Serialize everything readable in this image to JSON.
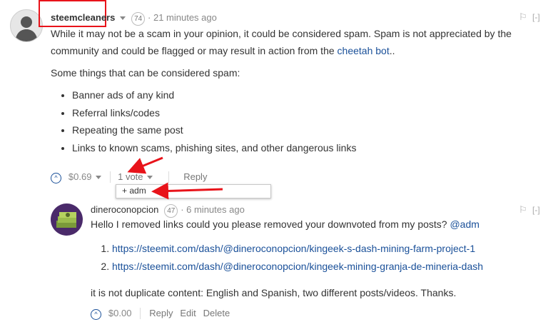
{
  "comment1": {
    "author": "steemcleaners",
    "reputation": "74",
    "time": "21 minutes ago",
    "collapse_label": "[-]",
    "paragraph1_a": "While it may not be a scam in your opinion, it could be considered spam. Spam is not appreciated by the community and could be flagged or may result in action from the ",
    "paragraph1_link": "cheetah bot",
    "paragraph1_b": "..",
    "paragraph2": "Some things that can be considered spam:",
    "list": [
      "Banner ads of any kind",
      "Referral links/codes",
      "Repeating the same post",
      "Links to known scams, phishing sites, and other dangerous links"
    ],
    "payout": "$0.69",
    "votes": "1 vote",
    "reply_label": "Reply",
    "voter": "+ adm"
  },
  "comment2": {
    "author": "dineroconopcion",
    "reputation": "47",
    "time": "6 minutes ago",
    "collapse_label": "[-]",
    "paragraph1": "Hello I removed links could you please removed your downvoted from my posts? ",
    "mention": "@adm",
    "links": [
      "https://steemit.com/dash/@dineroconopcion/kingeek-s-dash-mining-farm-project-1",
      "https://steemit.com/dash/@dineroconopcion/kingeek-mining-granja-de-mineria-dash"
    ],
    "paragraph2": "it is not duplicate content: English and Spanish, two different posts/videos. Thanks.",
    "payout": "$0.00",
    "reply_label": "Reply",
    "edit_label": "Edit",
    "delete_label": "Delete"
  },
  "colors": {
    "link": "#1a5099",
    "annotation_red": "#e8131a"
  }
}
